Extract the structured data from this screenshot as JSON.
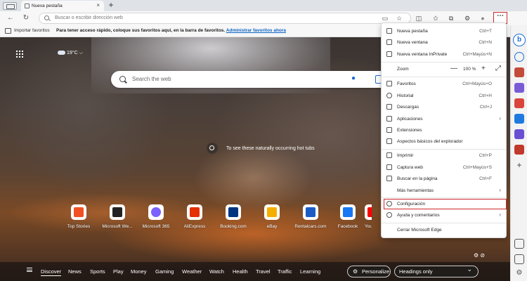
{
  "tabbar": {
    "tab_title": "Nueva pestaña",
    "close_glyph": "×",
    "new_tab_glyph": "+"
  },
  "toolbar": {
    "back_glyph": "←",
    "refresh_glyph": "↻",
    "address_placeholder": "Buscar o escribir dirección web",
    "menu_glyph": "⋯"
  },
  "favorites_bar": {
    "import_label": "Importar favoritos",
    "hint": "Para tener acceso rápido, coloque sus favoritos aquí, en la barra de favoritos.",
    "manage_link": "Administrar favoritos ahora"
  },
  "newtab": {
    "weather": "19°C",
    "weather_chevron": "⌵",
    "search_placeholder": "Search the web",
    "image_caption": "To see these naturally occurring hot tubs",
    "tiles": [
      {
        "label": "Top Stories",
        "color": "#f25022"
      },
      {
        "label": "Microsoft We...",
        "color": "#222222"
      },
      {
        "label": "Microsoft 365",
        "color": "#7b61ff"
      },
      {
        "label": "AliExpress",
        "color": "#e62e04"
      },
      {
        "label": "Booking.com",
        "color": "#003580"
      },
      {
        "label": "eBay",
        "color": "#f5af02"
      },
      {
        "label": "Rentalcars.com",
        "color": "#1a5cc4"
      },
      {
        "label": "Facebook",
        "color": "#1877f2"
      },
      {
        "label": "YouTube",
        "color": "#ff0000"
      }
    ],
    "feed": {
      "items": [
        "Discover",
        "News",
        "Sports",
        "Play",
        "Money",
        "Gaming",
        "Weather",
        "Watch",
        "Health",
        "Travel",
        "Traffic",
        "Learning"
      ],
      "personalize_label": "Personalize",
      "headings_label": "Headings only"
    }
  },
  "menu": {
    "items": [
      {
        "label": "Nueva pestaña",
        "shortcut": "Ctrl+T"
      },
      {
        "label": "Nueva ventana",
        "shortcut": "Ctrl+N"
      },
      {
        "label": "Nueva ventana InPrivate",
        "shortcut": "Ctrl+Mayús+N"
      },
      {
        "label": "Zoom",
        "zoom_value": "100 %",
        "minus": "—",
        "plus": "+",
        "fullscreen": "⤢"
      },
      {
        "label": "Favoritos",
        "shortcut": "Ctrl+Mayús+O"
      },
      {
        "label": "Historial",
        "shortcut": "Ctrl+H"
      },
      {
        "label": "Descargas",
        "shortcut": "Ctrl+J"
      },
      {
        "label": "Aplicaciones",
        "arrow": "›"
      },
      {
        "label": "Extensiones"
      },
      {
        "label": "Aspectos básicos del explorador"
      },
      {
        "label": "Imprimir",
        "shortcut": "Ctrl+P"
      },
      {
        "label": "Captura web",
        "shortcut": "Ctrl+Mayús+S"
      },
      {
        "label": "Buscar en la página",
        "shortcut": "Ctrl+F"
      },
      {
        "label": "Más herramientas",
        "arrow": "›"
      },
      {
        "label": "Configuración"
      },
      {
        "label": "Ayuda y comentarios",
        "arrow": "›"
      },
      {
        "label": "Cerrar Microsoft Edge"
      }
    ],
    "highlight_color": "#d0282b"
  },
  "sidebar": {
    "bing_label": "b"
  }
}
